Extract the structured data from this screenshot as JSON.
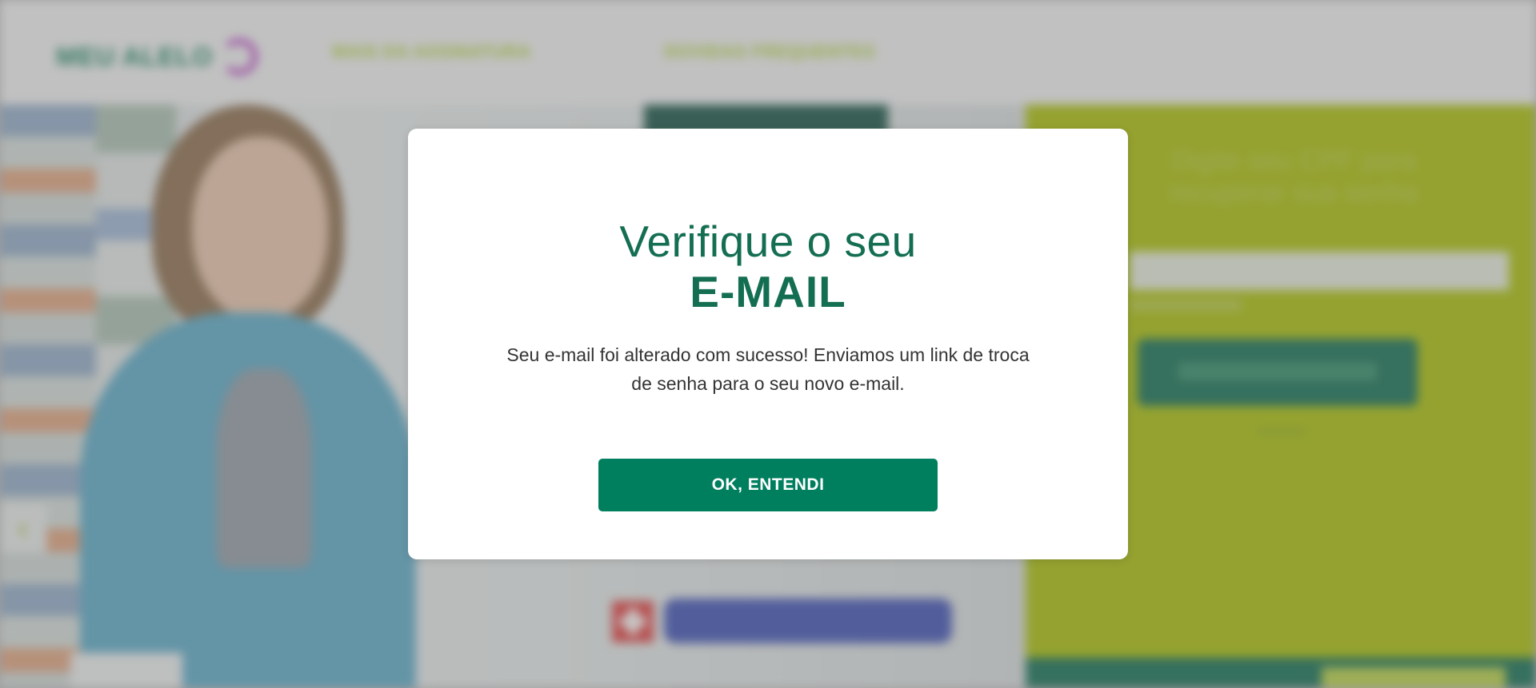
{
  "header": {
    "logo_text": "MEU ALELO",
    "nav": [
      {
        "label": "MAIS DA ASSINATURA"
      },
      {
        "label": "DÚVIDAS FREQUENTES"
      }
    ]
  },
  "hero": {
    "slider_prev_icon": "chevron-left-icon",
    "slider_prev_glyph": "‹"
  },
  "side_panel": {
    "title": "Digite seu CPF para recuperar sua senha",
    "recover_button_label": "RECUPERAR SENHA"
  },
  "modal": {
    "title_line1": "Verifique o seu",
    "title_line2": "E-MAIL",
    "message": "Seu e-mail foi alterado com sucesso! Enviamos um link de troca de senha para o seu novo e-mail.",
    "confirm_button_label": "OK, ENTENDI"
  },
  "colors": {
    "brand_green": "#146e52",
    "button_green": "#007f5f",
    "side_panel_lime": "#a8bf00",
    "accent_purple": "#b63dc4"
  }
}
